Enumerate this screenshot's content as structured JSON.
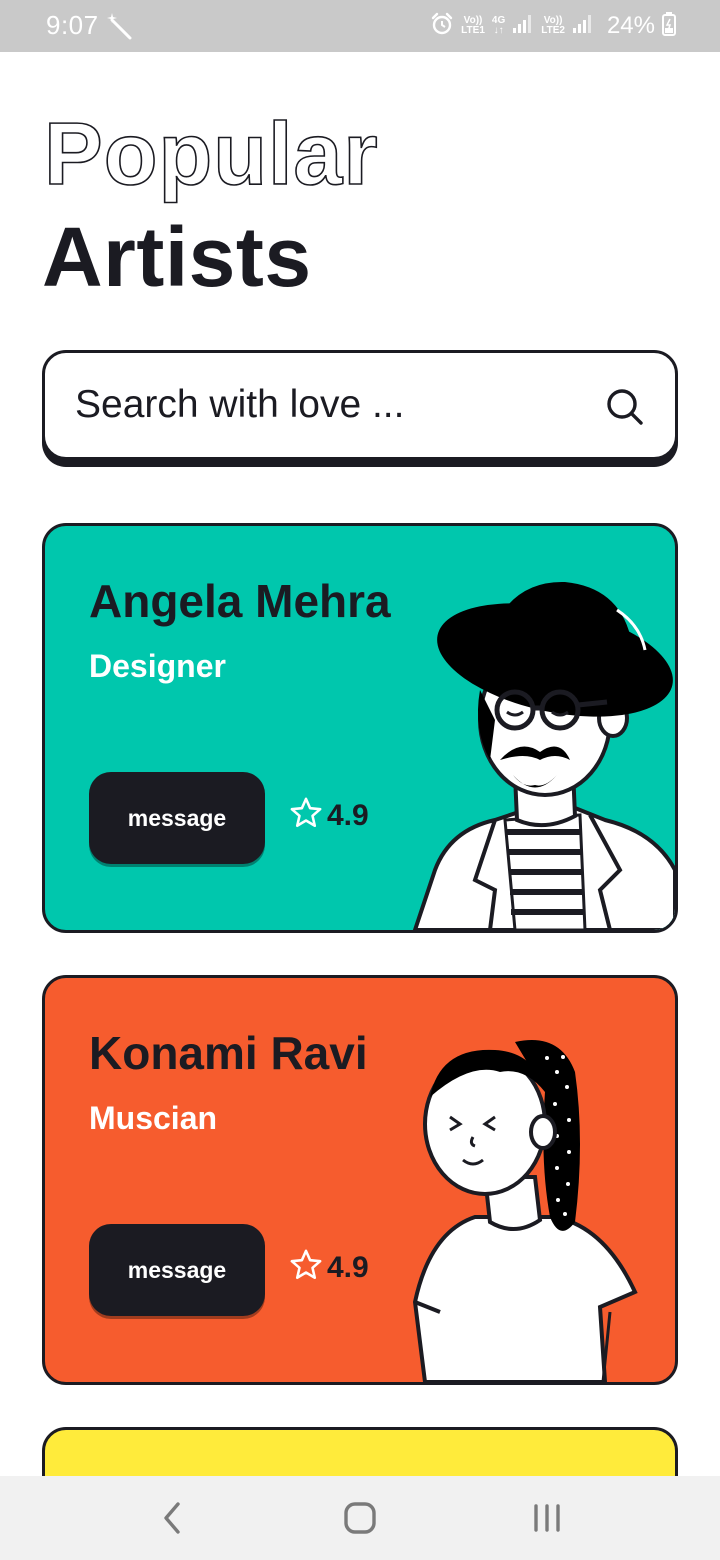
{
  "status_bar": {
    "time": "9:07",
    "sim1_top": "Vo))",
    "sim1_bottom": "LTE1",
    "network": "4G",
    "sim2_top": "Vo))",
    "sim2_bottom": "LTE2",
    "battery": "24%",
    "icons": [
      "magic-wand-icon",
      "alarm-icon",
      "signal-icon",
      "signal-icon",
      "battery-icon"
    ]
  },
  "header": {
    "line1": "Popular",
    "line2": "Artists"
  },
  "search": {
    "placeholder": "Search with love ...",
    "icon": "search-icon"
  },
  "artists": [
    {
      "name": "Angela Mehra",
      "role": "Designer",
      "button_label": "message",
      "rating": "4.9",
      "card_color": "#00c7ad"
    },
    {
      "name": "Konami Ravi",
      "role": "Muscian",
      "button_label": "message",
      "rating": "4.9",
      "card_color": "#f65c2e"
    },
    {
      "card_color": "#ffeb3b"
    }
  ],
  "nav_bar": {
    "icons": [
      "back-icon",
      "home-icon",
      "recents-icon"
    ]
  },
  "colors": {
    "ink": "#1b1b22",
    "teal": "#00c7ad",
    "orange": "#f65c2e",
    "yellow": "#ffeb3b"
  }
}
